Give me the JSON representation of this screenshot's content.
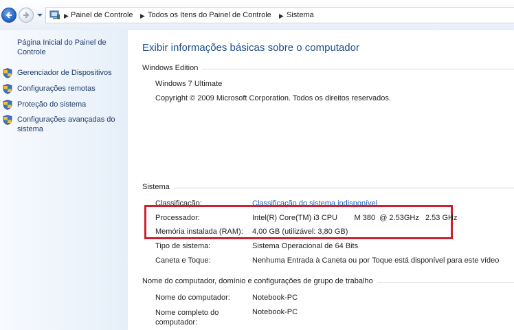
{
  "breadcrumb": {
    "items": [
      "Painel de Controle",
      "Todos os Itens do Painel de Controle",
      "Sistema"
    ]
  },
  "sidebar": {
    "home_link": "Página Inicial do Painel de Controle",
    "items": [
      {
        "label": "Gerenciador de Dispositivos",
        "icon": "shield-icon"
      },
      {
        "label": "Configurações remotas",
        "icon": "shield-icon"
      },
      {
        "label": "Proteção do sistema",
        "icon": "shield-icon"
      },
      {
        "label": "Configurações avançadas do sistema",
        "icon": "shield-icon"
      }
    ]
  },
  "main": {
    "title": "Exibir informações básicas sobre o computador",
    "windows_edition": {
      "header": "Windows Edition",
      "edition": "Windows 7 Ultimate",
      "copyright": "Copyright © 2009 Microsoft Corporation. Todos os direitos reservados."
    },
    "system": {
      "header": "Sistema",
      "rows": [
        {
          "label": "Classificação:",
          "value": "Classificação do sistema indisponível",
          "is_link": true
        },
        {
          "label": "Processador:",
          "value": "Intel(R) Core(TM) i3 CPU        M 380  @ 2.53GHz   2.53 GHz"
        },
        {
          "label": "Memória instalada (RAM):",
          "value": "4,00 GB (utilizável: 3,80 GB)"
        },
        {
          "label": "Tipo de sistema:",
          "value": "Sistema Operacional de 64 Bits"
        },
        {
          "label": "Caneta e Toque:",
          "value": "Nenhuma Entrada à Caneta ou por Toque está disponível para este vídeo"
        }
      ]
    },
    "computer_name": {
      "header": "Nome do computador, domínio e configurações de grupo de trabalho",
      "rows": [
        {
          "label": "Nome do computador:",
          "value": "Notebook-PC"
        },
        {
          "label": "Nome completo do computador:",
          "value": "Notebook-PC"
        }
      ]
    }
  },
  "colors": {
    "accent_title": "#1e4f8a",
    "link": "#1f5fb4",
    "highlight_box": "#d0202f"
  }
}
